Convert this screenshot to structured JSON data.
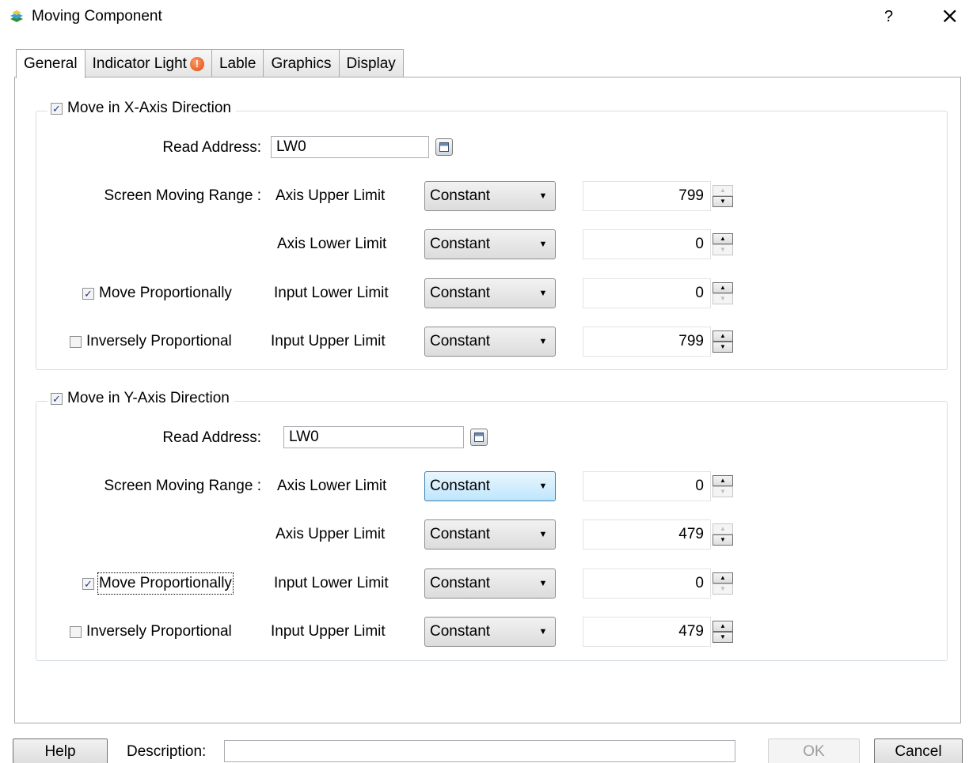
{
  "window": {
    "title": "Moving Component",
    "help_glyph": "?",
    "close_glyph": "×"
  },
  "tabs": [
    {
      "label": "General",
      "active": true
    },
    {
      "label": "Indicator Light",
      "warning": true
    },
    {
      "label": "Lable"
    },
    {
      "label": "Graphics"
    },
    {
      "label": "Display"
    }
  ],
  "x_axis": {
    "enabled_label": "Move in X-Axis Direction",
    "enabled": true,
    "read_address_label": "Read Address:",
    "read_address": "LW0",
    "screen_range_label": "Screen Moving Range :",
    "rows": [
      {
        "label": "Axis Upper Limit",
        "type": "Constant",
        "value": "799"
      },
      {
        "label": "Axis Lower Limit",
        "type": "Constant",
        "value": "0"
      },
      {
        "label": "Input Lower Limit",
        "type": "Constant",
        "value": "0"
      },
      {
        "label": "Input Upper Limit",
        "type": "Constant",
        "value": "799"
      }
    ],
    "move_proportionally_label": "Move Proportionally",
    "move_proportionally": true,
    "inversely_proportional_label": "Inversely Proportional",
    "inversely_proportional": false
  },
  "y_axis": {
    "enabled_label": "Move in Y-Axis Direction",
    "enabled": true,
    "read_address_label": "Read Address:",
    "read_address": "LW0",
    "screen_range_label": "Screen Moving Range :",
    "rows": [
      {
        "label": "Axis Lower Limit",
        "type": "Constant",
        "value": "0"
      },
      {
        "label": "Axis Upper Limit",
        "type": "Constant",
        "value": "479"
      },
      {
        "label": "Input Lower Limit",
        "type": "Constant",
        "value": "0"
      },
      {
        "label": "Input Upper Limit",
        "type": "Constant",
        "value": "479"
      }
    ],
    "move_proportionally_label": "Move Proportionally",
    "move_proportionally": true,
    "inversely_proportional_label": "Inversely Proportional",
    "inversely_proportional": false
  },
  "footer": {
    "help_label": "Help",
    "description_label": "Description:",
    "description_value": "",
    "ok_label": "OK",
    "cancel_label": "Cancel"
  },
  "glyphs": {
    "check": "✓",
    "dropdown": "▼",
    "spin_up": "▲",
    "spin_down": "▼",
    "warning": "!"
  },
  "colors": {
    "combo_focus": "#bee6fd",
    "checkmark": "#233a8f",
    "warning": "#e04a10"
  }
}
